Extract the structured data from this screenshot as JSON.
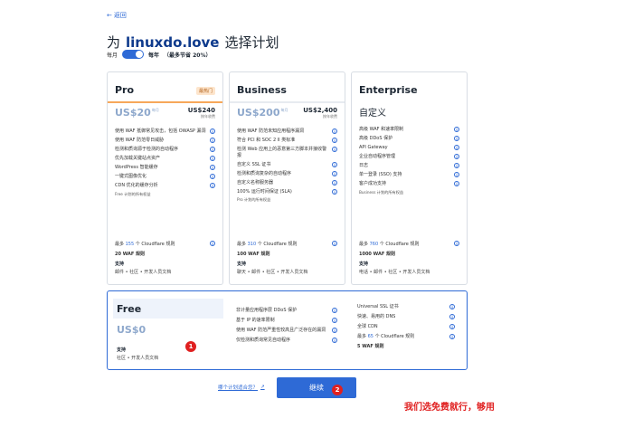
{
  "back_label": "返回",
  "title": {
    "prefix": "为",
    "domain": "linuxdo.love",
    "suffix": "选择计划"
  },
  "billing": {
    "monthly": "每月",
    "yearly": "每年",
    "savings": "（最多节省 20%）"
  },
  "plans": {
    "pro": {
      "name": "Pro",
      "badge": "最热门",
      "price": "US$20",
      "per": "每月",
      "year_price": "US$240",
      "year_note": "按年收费",
      "features": [
        "使用 WAF 抵御常见攻击，包括 OWASP 漏洞",
        "使用 WAF 防范零日威胁",
        "检测和质询源于检测的自动程序",
        "优先加载关键站点资产",
        "WordPress 智能缓存",
        "一键式图像优化",
        "CDN 优化的缓存分析"
      ],
      "note": "Free 计划的所有权益",
      "rules_prefix": "最多",
      "rules_count": "155",
      "rules_suffix": "个 Cloudflare 规则",
      "waf": "20 WAF 规则",
      "support_label": "支持",
      "support": "邮件 • 社区 • 开发人员文档"
    },
    "business": {
      "name": "Business",
      "price": "US$200",
      "per": "每月",
      "year_price": "US$2,400",
      "year_note": "按年收费",
      "features": [
        "使用 WAF 防范未知应用程序漏洞",
        "符合 PCI 和 SOC 2 II 类标准",
        "检测 Web 应用上的恶意第三方脚本并接收警报",
        "自定义 SSL 证书",
        "检测和质询复杂的自动程序",
        "自定义名称服务器",
        "100% 运行时间保证 (SLA)"
      ],
      "note": "Pro 计划的所有权益",
      "rules_prefix": "最多",
      "rules_count": "310",
      "rules_suffix": "个 Cloudflare 规则",
      "waf": "100 WAF 规则",
      "support_label": "支持",
      "support": "聊天 • 邮件 • 社区 • 开发人员文档"
    },
    "enterprise": {
      "name": "Enterprise",
      "custom": "自定义",
      "features": [
        "高级 WAF 和速率限制",
        "高级 DDoS 保护",
        "API Gateway",
        "企业自动程序管理",
        "日志",
        "单一登录 (SSO) 支持",
        "客户成功支持"
      ],
      "note": "Business 计划的所有权益",
      "rules_prefix": "最多",
      "rules_count": "760",
      "rules_suffix": "个 Cloudflare 规则",
      "waf": "1000 WAF 规则",
      "support_label": "支持",
      "support": "电话 • 邮件 • 社区 • 开发人员文档"
    },
    "free": {
      "name": "Free",
      "price": "US$0",
      "support_label": "支持",
      "support": "社区 • 开发人员文档",
      "col1": [
        "非计量应用程序层 DDoS 保护",
        "基于 IP 的速率限制",
        "使用 WAF 防范严重性较高且广泛存在的漏洞",
        "仅检测和质询常见自动程序"
      ],
      "col2": [
        "Universal SSL 证书",
        "快速、易用的 DNS",
        "全球 CDN"
      ],
      "rules_prefix": "最多",
      "rules_count": "65",
      "rules_suffix": "个 Cloudflare 规则",
      "waf": "5 WAF 规则"
    }
  },
  "help_link": "哪个计划适合您？",
  "continue_label": "继续",
  "markers": {
    "one": "1",
    "two": "2"
  },
  "annotation": "我们选免费就行，够用",
  "colors": {
    "accent": "#2e6ad6",
    "annotation": "#e02020"
  }
}
